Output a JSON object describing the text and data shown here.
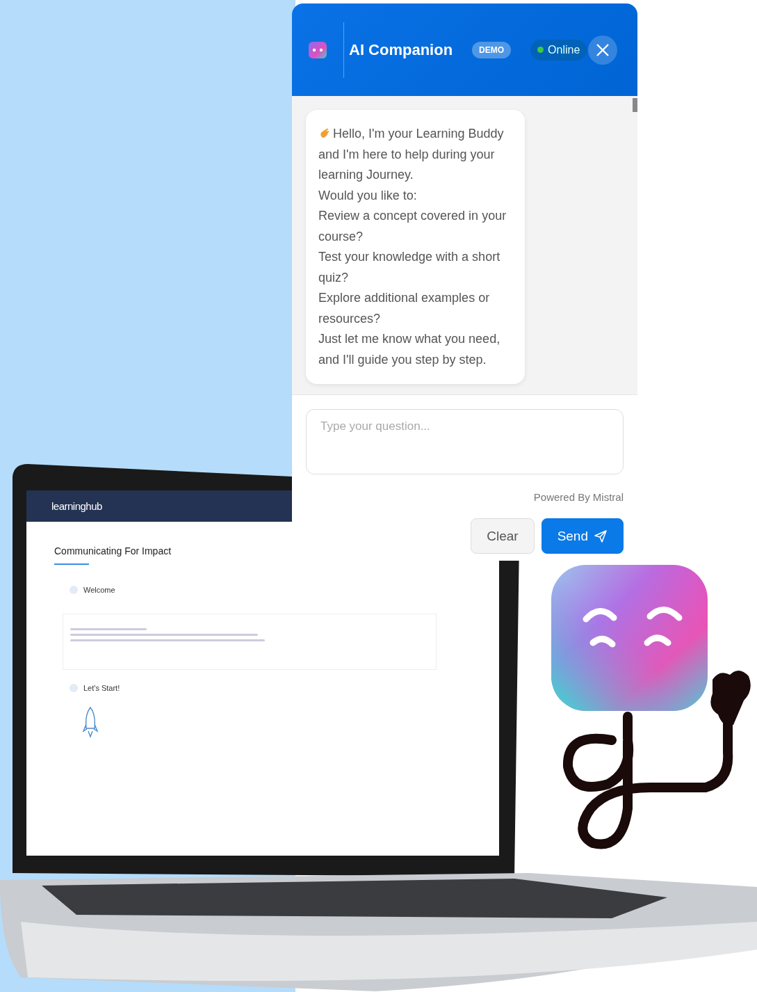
{
  "chat": {
    "title": "AI Companion",
    "badge": "DEMO",
    "status": {
      "label": "Online",
      "online": true
    },
    "messages": [
      {
        "lines": [
          "Hello, I'm your Learning Buddy and I'm here to help during your learning Journey.",
          "Would you like to:",
          "Review a concept covered in your course?",
          "Test your knowledge with a short quiz?",
          "Explore additional examples or resources?",
          "Just let me know what you need, and I'll guide you step by step."
        ]
      }
    ],
    "input": {
      "placeholder": "Type your question..."
    },
    "powered_by": "Powered By Mistral",
    "buttons": [
      {
        "label": "Clear",
        "kind": "secondary"
      },
      {
        "label": "Send",
        "kind": "primary"
      }
    ]
  },
  "laptop_screen": {
    "logo": "learninghub",
    "course_title": "Communicating For Impact",
    "sections": [
      "Welcome",
      "Let's Start!"
    ]
  }
}
